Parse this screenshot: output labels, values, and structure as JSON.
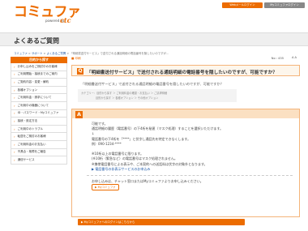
{
  "header": {
    "logo_text": "コミュファ",
    "logo_powered": "powered by",
    "logo_ctc": "ctc",
    "buttons": [
      "Webメールログイン",
      "Myコミュファログイン"
    ]
  },
  "page_title": "よくあるご質問",
  "breadcrumb": {
    "items": [
      "コミュファ",
      "サポート",
      "よくあるご質問",
      "「明細書送付サービス」で送付される通話明細の電話番号を隠したいのですが..."
    ],
    "sep": " > "
  },
  "sidebar": {
    "heading": "目的から探す",
    "items": [
      "お申し込みをご検討中のお客様",
      "ご利用開始・接続までのご案内",
      "ご契約内容・変更・解約",
      "各種オプション",
      "ご利用料金・請求について",
      "ご利用中の機器について",
      "ID・パスワード・Myコミュファ",
      "接続・設定方法",
      "ご利用中のトラブル",
      "転居をご検討のお客様",
      "ご利用料金のお支払い",
      "不具合・故障をご報告",
      "通信サービス"
    ]
  },
  "main": {
    "print_label": "印刷",
    "qno": "No : 435",
    "text_size": "文字サイズ",
    "question_icon": "Q",
    "question_title": "「明細書送付サービス」で送付される通話明細の電話番号を隠したいのですが、可能ですか？",
    "question_body": "「明細書送付サービス」で送付される通話明細の電話番号を隠したいのですが、可能ですか？",
    "category_label": "カテゴリー：",
    "categories": [
      "目的から探す ＞ ご利用料金の確認・お支払い ＞ ご請求明細",
      "目的から探す ＞ 各種オプション ＞ その他オプション"
    ],
    "answer_icon": "A",
    "answer_lines": [
      "可能です。",
      "通話明細の履歴（電話番号）の下4桁を秘匿（マスク処理）することを選択いただけます。",
      "↓",
      "電話番号の下4桁を「****」と伏字し通話先を特定できなくします。",
      "例）090-1234-****",
      "",
      "※10桁以上の電話番号に限ります。",
      "(※10桁（緊急など）の電話番号はマスク処理されません。",
      "※携帯電話番号による表示や、ご本契約への送話料は伏字の対象外となります。",
      "▶ 電話番号の非表示サービスのお申込み"
    ],
    "answer2_lines": [
      "お申し込みは、チャット窓口またはMyコミュファよりお申し込みください。",
      "▶ Myコミュファ"
    ],
    "bottom_bar": "▶ Myコミュファへのログインはこちらから"
  }
}
